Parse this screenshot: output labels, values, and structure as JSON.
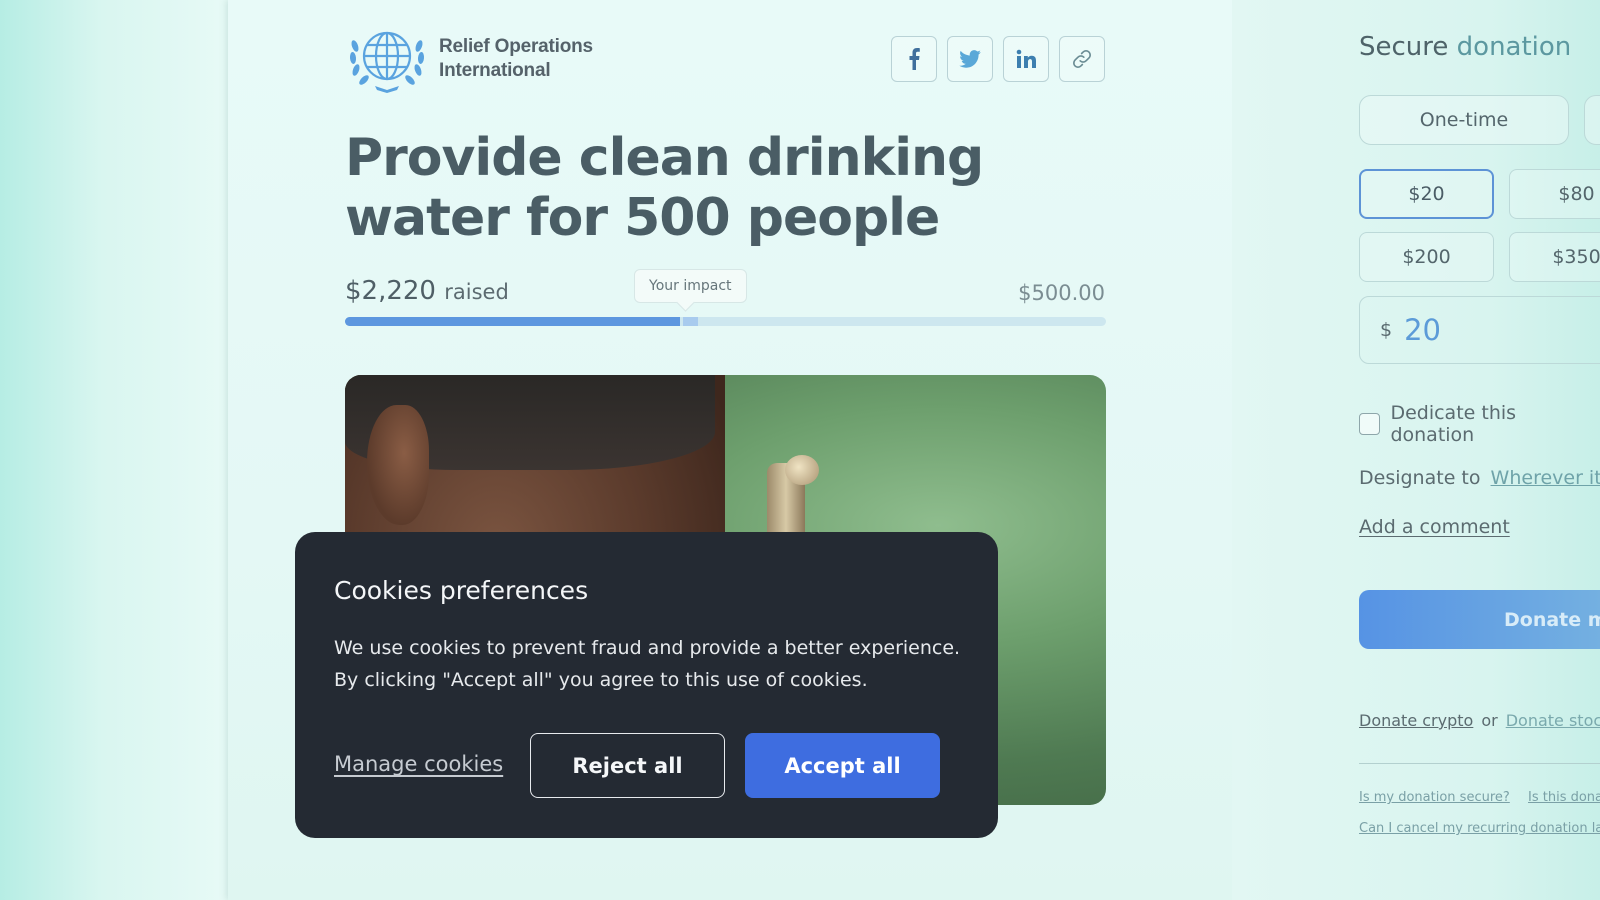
{
  "brand": {
    "name_line1": "Relief Operations",
    "name_line2": "International",
    "accent": "#5d97df"
  },
  "social": [
    {
      "icon": "facebook-icon",
      "glyph": "f"
    },
    {
      "icon": "twitter-icon",
      "glyph": "t"
    },
    {
      "icon": "linkedin-icon",
      "glyph": "in"
    },
    {
      "icon": "link-icon",
      "glyph": "link"
    }
  ],
  "campaign": {
    "title": "Provide clean drinking water for 500 people",
    "raised_amount": "$2,220",
    "raised_label": "raised",
    "goal": "$500.00",
    "impact_tooltip": "Your impact",
    "progress_fraction": 0.44,
    "impact_fraction": 0.02
  },
  "cookie_banner": {
    "title": "Cookies preferences",
    "body": "We use cookies to prevent fraud and provide a better experience. By clicking \"Accept all\" you agree to this use of cookies.",
    "manage_label": "Manage cookies",
    "reject_label": "Reject all",
    "accept_label": "Accept all",
    "accept_color": "#3e6de0"
  },
  "donation_panel": {
    "title_part1": "Secure",
    "title_part2": "donation",
    "frequency": [
      "One-time"
    ],
    "amounts": [
      "$20",
      "$80",
      "$200",
      "$350"
    ],
    "selected_amount": "$20",
    "currency_symbol": "$",
    "amount_value": "20",
    "dedicate_label": "Dedicate this donation",
    "designate_label": "Designate to",
    "designate_value": "Wherever it’s n",
    "add_comment": "Add a comment",
    "donate_button": "Donate mo",
    "donate_crypto": "Donate crypto",
    "or": "or",
    "donate_stock": "Donate stock",
    "faq": [
      "Is my donation secure?",
      "Is this dona",
      "Can I cancel my recurring donation la"
    ]
  }
}
